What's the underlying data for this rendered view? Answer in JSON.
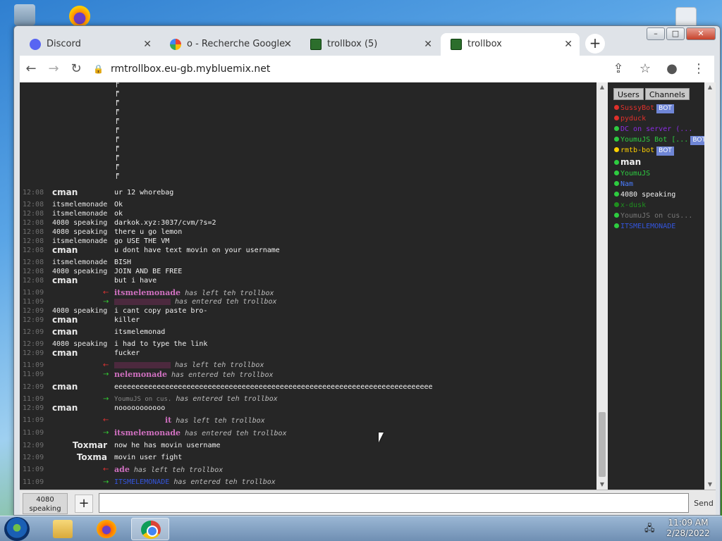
{
  "browser": {
    "tabs": [
      {
        "label": "Discord",
        "icon": "discord-icon"
      },
      {
        "label": "o - Recherche Google",
        "icon": "google-icon"
      },
      {
        "label": "trollbox (5)",
        "icon": "trollbox-icon"
      },
      {
        "label": "trollbox",
        "icon": "trollbox-icon"
      }
    ],
    "url": "rmtrollbox.eu-gb.mybluemix.net"
  },
  "chat": {
    "messages": [
      {
        "ts": "12:08",
        "nick": "cman",
        "text": "ur 12 whorebag"
      },
      {
        "ts": "12:08",
        "nick": "itsmelemonade",
        "text": "Ok"
      },
      {
        "ts": "12:08",
        "nick": "itsmelemonade",
        "text": "ok"
      },
      {
        "ts": "12:08",
        "nick": "4080 speaking",
        "text": "darkok.xyz:3037/cvm/?s=2"
      },
      {
        "ts": "12:08",
        "nick": "4080 speaking",
        "text": "there u go lemon"
      },
      {
        "ts": "12:08",
        "nick": "itsmelemonade",
        "text": "go USE THE VM"
      },
      {
        "ts": "12:08",
        "nick": "cman",
        "text": "u dont have text movin on your username"
      },
      {
        "ts": "12:08",
        "nick": "itsmelemonade",
        "text": "BISH"
      },
      {
        "ts": "12:08",
        "nick": "4080 speaking",
        "text": "JOIN AND BE FREE"
      },
      {
        "ts": "12:08",
        "nick": "cman",
        "text": "but i have"
      },
      {
        "ts": "11:09",
        "arrow": "←",
        "actor": "itsmelemonade",
        "event": "has left teh trollbox"
      },
      {
        "ts": "11:09",
        "arrow": "→",
        "actor": "",
        "event": "has entered teh trollbox"
      },
      {
        "ts": "12:09",
        "nick": "4080 speaking",
        "text": "i cant copy paste bro-"
      },
      {
        "ts": "12:09",
        "nick": "cman",
        "text": "killer"
      },
      {
        "ts": "12:09",
        "nick": "cman",
        "text": "itsmelemonad"
      },
      {
        "ts": "12:09",
        "nick": "4080 speaking",
        "text": "i had to type the link"
      },
      {
        "ts": "12:09",
        "nick": "cman",
        "text": "fucker"
      },
      {
        "ts": "11:09",
        "arrow": "←",
        "actor": "",
        "event": "has left teh trollbox"
      },
      {
        "ts": "11:09",
        "arrow": "→",
        "actor": "nelemonade",
        "event": "has entered teh trollbox"
      },
      {
        "ts": "12:09",
        "nick": "cman",
        "text": "eeeeeeeeeeeeeeeeeeeeeeeeeeeeeeeeeeeeeeeeeeeeeeeeeeeeeeeeeeeeeeeeeeeeeeeeeee"
      },
      {
        "ts": "11:09",
        "arrow": "→",
        "actor": "YoumuJS on cus.",
        "event": "has entered teh trollbox"
      },
      {
        "ts": "12:09",
        "nick": "cman",
        "text": "nooooooooooo"
      },
      {
        "ts": "11:09",
        "arrow": "←",
        "actor": "it",
        "event": "has left teh trollbox"
      },
      {
        "ts": "11:09",
        "arrow": "→",
        "actor": "itsmelemonade",
        "event": "has entered teh trollbox"
      },
      {
        "ts": "12:09",
        "nick": "Toxmar",
        "text": "now he has movin username"
      },
      {
        "ts": "12:09",
        "nick": "Toxma",
        "text": "movin user fight"
      },
      {
        "ts": "11:09",
        "arrow": "←",
        "actor": "ade",
        "event": "has left teh trollbox"
      },
      {
        "ts": "11:09",
        "arrow": "→",
        "actor": "ITSMELEMONADE",
        "event": "has entered teh trollbox"
      }
    ]
  },
  "panel": {
    "tabs": [
      "Users",
      "Channels"
    ],
    "users": [
      {
        "name": "SussyBot",
        "color": "#e0302b",
        "bot": true
      },
      {
        "name": "pyduck",
        "color": "#e0302b"
      },
      {
        "name": "DC on server (...",
        "color": "#8a2be2"
      },
      {
        "name": "YoumuJS Bot [...",
        "color": "#2ecc40",
        "bot": true
      },
      {
        "name": "rmtb-bot",
        "color": "#ffd000",
        "bot": true
      },
      {
        "name": "man",
        "color": "#f0f0f0"
      },
      {
        "name": "YoumuJS",
        "color": "#2ecc40"
      },
      {
        "name": "Nam",
        "color": "#4a7dff"
      },
      {
        "name": "4080 speaking",
        "color": "#f0f0f0"
      },
      {
        "name": "x-dusk",
        "color": "#1f8f1f"
      },
      {
        "name": "YoumuJS on cus...",
        "color": "#777777"
      },
      {
        "name": "ITSMELEMONADE",
        "color": "#3355dd"
      }
    ],
    "bot_label": "BOT"
  },
  "input": {
    "speaker": "4080 speaking",
    "plus": "+",
    "value": "",
    "send": "Send"
  },
  "taskbar": {
    "time": "11:09 AM",
    "date": "2/28/2022"
  }
}
